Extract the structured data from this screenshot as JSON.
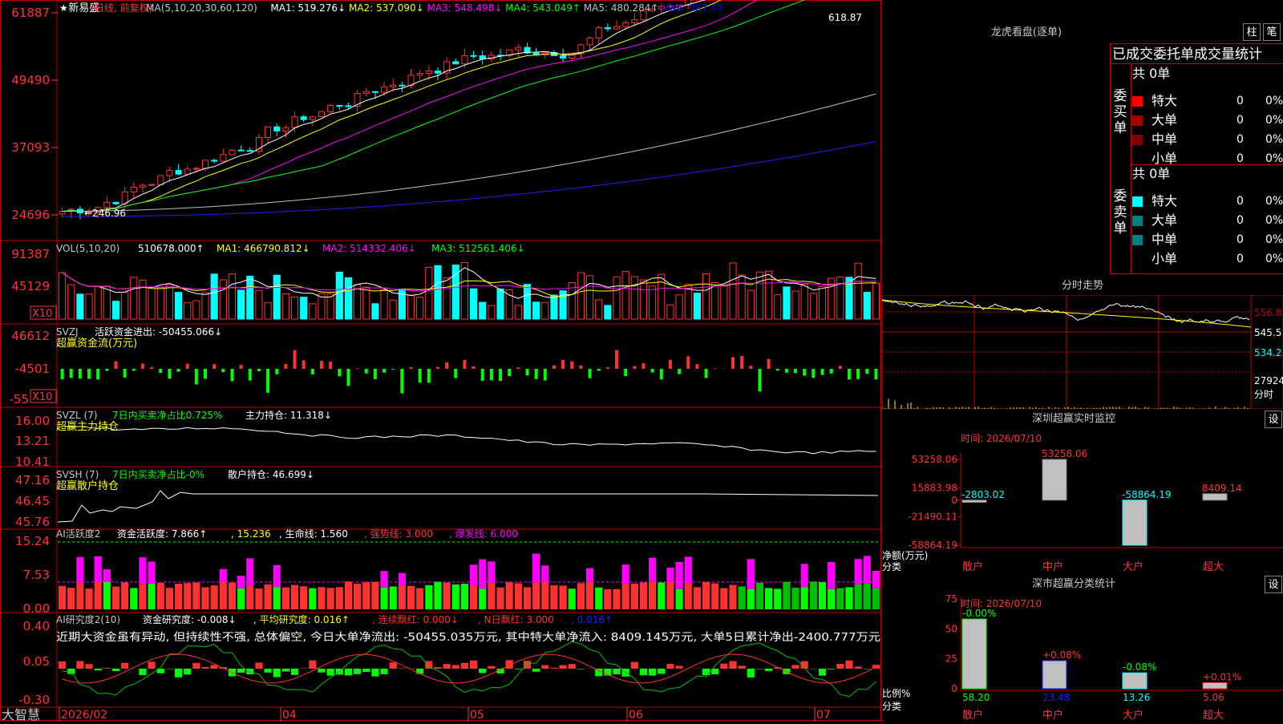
{
  "app": {
    "logo": "大智慧"
  },
  "main": {
    "title_line": {
      "star": "★",
      "stock": "新易盛",
      "mode": "(日线, 前复权)",
      "ma_label": "MA(5,10,20,30,60,120)",
      "items": [
        {
          "t": "MA1: 519.276",
          "arrow": "↓",
          "color": "#ffffff"
        },
        {
          "t": "MA2: 537.090",
          "arrow": "↓",
          "color": "#ffff00"
        },
        {
          "t": "MA3: 548.498",
          "arrow": "↓",
          "color": "#ff00ff"
        },
        {
          "t": "MA4: 543.049",
          "arrow": "↑",
          "color": "#00ff00"
        },
        {
          "t": "MA5: 480.284",
          "arrow": "↑",
          "color": "#c0c0c0"
        },
        {
          "t": "MA6: 387.49",
          "arrow": "",
          "color": "#0000ff"
        }
      ]
    },
    "price_axis": [
      "61887",
      "49490",
      "37093",
      "24696"
    ],
    "max_label": "618.87",
    "min_label": "←246.96",
    "vol": {
      "label": "VOL(5,10,20)",
      "value": "510678.000",
      "ma1": "MA1: 466790.812",
      "ma2": "MA2: 514332.406",
      "ma3": "MA3: 512561.406",
      "axis": [
        "91387",
        "45129"
      ],
      "x10": "X10"
    },
    "svzj": {
      "label": "SVZJ",
      "text": "活跃资金进出: -50455.066",
      "sub": "超赢资金流(万元)",
      "axis": [
        "46612",
        "-4501",
        "-55"
      ],
      "x10": "X10"
    },
    "svzl": {
      "label": "SVZL (7)",
      "text1": "7日内买卖净占比0.725%",
      "text2": "主力持仓: 11.318",
      "sub": "超赢主力持仓",
      "axis": [
        "16.00",
        "13.21",
        "10.41"
      ]
    },
    "svsh": {
      "label": "SVSH (7)",
      "text1": "7日内买卖净占比-0%",
      "text2": "散户持仓: 46.699",
      "sub": "超赢散户持仓",
      "axis": [
        "47.16",
        "46.45",
        "45.76"
      ]
    },
    "ai1": {
      "label": "AI活跃度2",
      "t1": "资金活跃度: 7.866",
      "t2": "15.236",
      "t3": "生命线: 1.560",
      "t4": "强势线: 3.000",
      "t5": "爆发线: 6.000",
      "axis": [
        "15.24",
        "7.53",
        "0.00"
      ]
    },
    "ai2": {
      "label": "AI研究度2(10)",
      "t1": "资金研究度: -0.008",
      "t2": "平均研究度: 0.016",
      "t3": "连续飘红: 0.000",
      "t4": "N日飘红: 3.000",
      "t5": "0.016",
      "axis": [
        "0.40",
        "0.05",
        "-0.30"
      ],
      "comment": "近期大资金虽有异动, 但持续性不强, 总体偏空, 今日大单净流出: -50455.035万元, 其中特大单净流入: 8409.145万元, 大单5日累计净出-2400.777万元"
    },
    "dates": [
      "2026/02",
      "04",
      "05",
      "06",
      "07"
    ]
  },
  "right": {
    "longhu": {
      "title": "龙虎看盘(逐单)",
      "btn1": "柱",
      "btn2": "笔",
      "header": "已成交委托单成交量统计",
      "buy": {
        "side": "委买单",
        "total": "共 0单",
        "rows": [
          {
            "label": "特大",
            "v": "0",
            "p": "0%",
            "color": "#ff0000"
          },
          {
            "label": "大单",
            "v": "0",
            "p": "0%",
            "color": "#a00000"
          },
          {
            "label": "中单",
            "v": "0",
            "p": "0%",
            "color": "#800000"
          },
          {
            "label": "小单",
            "v": "0",
            "p": "0%",
            "color": "#000000"
          }
        ]
      },
      "sell": {
        "side": "委卖单",
        "total": "共 0单",
        "rows": [
          {
            "label": "特大",
            "v": "0",
            "p": "0%",
            "color": "#00ffff"
          },
          {
            "label": "大单",
            "v": "0",
            "p": "0%",
            "color": "#008080"
          },
          {
            "label": "中单",
            "v": "0",
            "p": "0%",
            "color": "#008080"
          },
          {
            "label": "小单",
            "v": "0",
            "p": "0%",
            "color": "#000000"
          }
        ]
      }
    },
    "fenshi": {
      "title": "分时走势",
      "axis": [
        "556.8",
        "545.5",
        "534.2"
      ],
      "vol_label": "27924",
      "unit": "分时"
    },
    "sz_monitor": {
      "title": "深圳超赢实时监控",
      "btn": "设",
      "time": "时间: 2026/07/10",
      "y_axis": [
        "53258.06",
        "15883.98",
        "0",
        "-21490.11",
        "-58864.19"
      ],
      "bottom_label1": "净额(万元)",
      "bottom_label2": "分类"
    },
    "sz_class": {
      "title": "深市超赢分类统计",
      "btn": "设",
      "time": "时间: 2026/07/10",
      "y_axis": [
        "75",
        "50",
        "25",
        "0"
      ],
      "bottom_label1": "比例%",
      "bottom_label2": "分类"
    }
  },
  "chart_data": [
    {
      "type": "bar",
      "title": "深圳超赢实时监控",
      "categories": [
        "散户",
        "中户",
        "大户",
        "超大"
      ],
      "values": [
        -2803.02,
        53258.06,
        -58864.19,
        8409.14
      ],
      "labels": [
        "-2803.02",
        "53258.06",
        "-58864.19",
        "8409.14"
      ],
      "ylim": [
        -58864.19,
        53258.06
      ],
      "ylabel": "净额(万元)",
      "xlabel": "分类"
    },
    {
      "type": "bar",
      "title": "深市超赢分类统计",
      "categories": [
        "散户",
        "中户",
        "大户",
        "超大"
      ],
      "values": [
        58.2,
        23.48,
        13.26,
        5.06
      ],
      "changes": [
        "-0.00%",
        "+0.08%",
        "-0.08%",
        "+0.01%"
      ],
      "labels": [
        "58.20",
        "23.48",
        "13.26",
        "5.06"
      ],
      "ylim": [
        0,
        75
      ],
      "ylabel": "比例%",
      "xlabel": "分类"
    }
  ]
}
